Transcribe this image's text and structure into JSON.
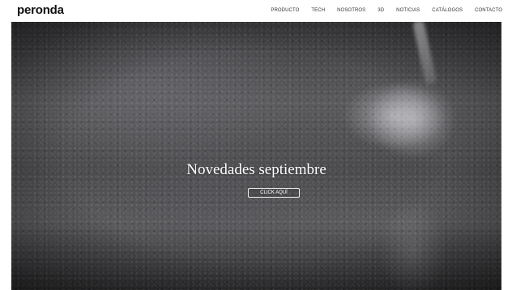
{
  "header": {
    "logo": "peronda",
    "nav": [
      {
        "label": "PRODUCTO"
      },
      {
        "label": "TECH"
      },
      {
        "label": "NOSOTROS"
      },
      {
        "label": "3D"
      },
      {
        "label": "NOTICIAS"
      },
      {
        "label": "CATÁLOGOS"
      },
      {
        "label": "CONTACTO"
      }
    ]
  },
  "hero": {
    "title": "Novedades septiembre",
    "cta_label": "CLICK AQUÍ"
  }
}
